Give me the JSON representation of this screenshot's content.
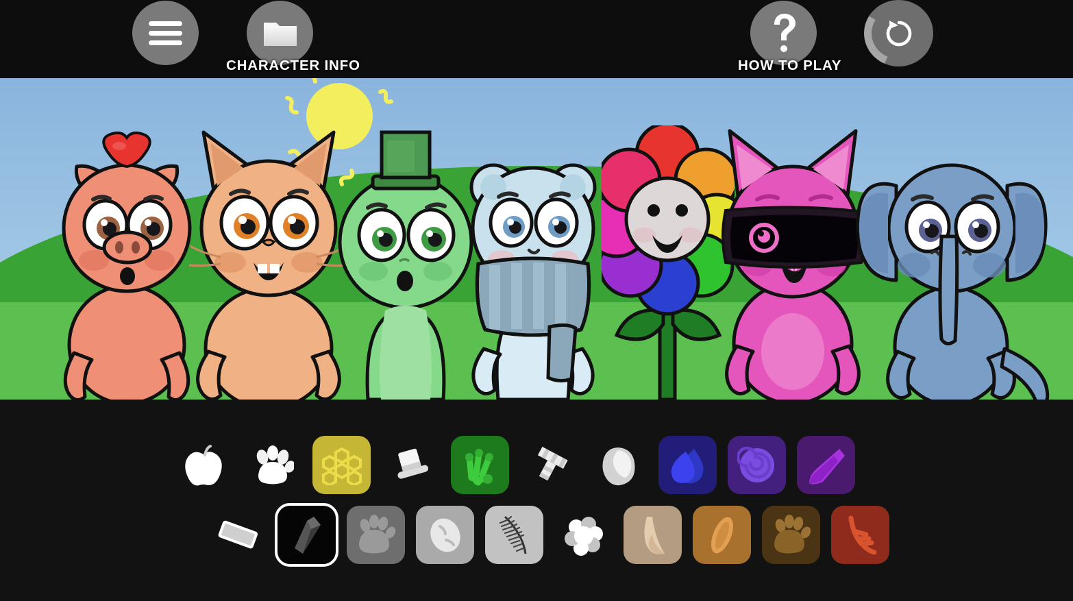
{
  "app": {
    "title": "Character Dress-Up Game",
    "background_color": "#0e0e0e"
  },
  "topbar": {
    "menu_button": {
      "name": "menu",
      "icon": "hamburger-icon",
      "caption": ""
    },
    "character_info_button": {
      "name": "character-info",
      "icon": "folder-icon",
      "caption": "CHARACTER INFO"
    },
    "how_to_play_button": {
      "name": "how-to-play",
      "icon": "question-mark-icon",
      "caption": "HOW TO PLAY"
    },
    "reset_button": {
      "name": "reset",
      "icon": "refresh-icon",
      "caption": "",
      "ring_progress_pct": 26
    },
    "colors": {
      "button_fill": "#7a7a7a",
      "ring_light": "#a6a6a6",
      "ring_dark": "#6e6e6e",
      "bar_bg": "#0d0d0d"
    }
  },
  "scene": {
    "sky_color": "#9ec6e4",
    "hill_color": "#3aa335",
    "ground_color": "#5bc04f",
    "sun_color": "#f3ee5e",
    "characters": [
      {
        "id": "pig",
        "label": "Pig",
        "body_color": "#f0937a",
        "accessory": "apple-on-head",
        "accessory_color": "#e8342f",
        "eye_color": "#9c6241",
        "expression": "surprised"
      },
      {
        "id": "cat-orange",
        "label": "Orange Cat",
        "body_color": "#f0b184",
        "accessory": "none",
        "eye_color": "#e08028",
        "expression": "happy"
      },
      {
        "id": "frog",
        "label": "Frog",
        "body_color": "#84d98a",
        "accessory": "top-hat",
        "accessory_color": "#3e8a43",
        "eye_color": "#3f9a44",
        "expression": "surprised"
      },
      {
        "id": "polar-bear",
        "label": "Polar Bear",
        "body_color": "#c9e1ed",
        "accessory": "striped-scarf",
        "accessory_color": "#7d98ab",
        "eye_color": "#6f9cc4",
        "expression": "sad"
      },
      {
        "id": "flower",
        "label": "Rainbow Flower",
        "body_color": "#ded7d7",
        "accessory": "rainbow-petals",
        "accessory_color": "#e8342f",
        "eye_color": "#000000",
        "expression": "smiling"
      },
      {
        "id": "cat-pink",
        "label": "Pink Cat",
        "body_color": "#e456bb",
        "accessory": "vr-visor",
        "accessory_color": "#15090f",
        "eye_color": "#ef6fc8",
        "expression": "grinning"
      },
      {
        "id": "elephant",
        "label": "Elephant",
        "body_color": "#7b9ec7",
        "accessory": "none",
        "eye_color": "#5b6192",
        "expression": "neutral"
      }
    ]
  },
  "palette": {
    "selected_tile_id": "black-crystal",
    "rows": [
      {
        "row": 1,
        "tiles": [
          {
            "id": "white-apple",
            "icon": "apple-icon",
            "tile_color": "transparent",
            "glyph_color": "#ffffff",
            "glyph2": "#cccccc"
          },
          {
            "id": "white-paw",
            "icon": "paw-print-icon",
            "tile_color": "transparent",
            "glyph_color": "#f1f1f1",
            "glyph2": "#ffffff"
          },
          {
            "id": "gold-honeycomb",
            "icon": "honeycomb-icon",
            "tile_color": "#c5b735",
            "glyph_color": "#eddc4a",
            "glyph2": "#d8c83e"
          },
          {
            "id": "white-tophat",
            "icon": "top-hat-icon",
            "tile_color": "transparent",
            "glyph_color": "#f5f5f5",
            "glyph2": "#cfcfcf"
          },
          {
            "id": "green-frogfoot",
            "icon": "frog-foot-icon",
            "tile_color": "#1d7a1d",
            "glyph_color": "#3ecb3e",
            "glyph2": "#35b035"
          },
          {
            "id": "white-scarf",
            "icon": "scarf-icon",
            "tile_color": "transparent",
            "glyph_color": "#ededed",
            "glyph2": "#c9c9c9"
          },
          {
            "id": "gray-pebble",
            "icon": "pebble-icon",
            "tile_color": "transparent",
            "glyph_color": "#d2d2d2",
            "glyph2": "#ffffff"
          },
          {
            "id": "blue-flame",
            "icon": "flame-icon",
            "tile_color": "#231d7a",
            "glyph_color": "#3b42ee",
            "glyph2": "#2f38c6"
          },
          {
            "id": "purple-spiral",
            "icon": "spiral-icon",
            "tile_color": "#43207d",
            "glyph_color": "#7c4ce0",
            "glyph2": "#6a3ecb"
          },
          {
            "id": "purple-tail",
            "icon": "brush-tail-icon",
            "tile_color": "#4a1a6e",
            "glyph_color": "#a832e0",
            "glyph2": "#8f22c6"
          }
        ]
      },
      {
        "row": 2,
        "tiles": [
          {
            "id": "white-bandage",
            "icon": "bandage-icon",
            "tile_color": "transparent",
            "glyph_color": "#cfcfcf",
            "glyph2": "#ffffff"
          },
          {
            "id": "black-crystal",
            "icon": "crystal-icon",
            "tile_color": "#050505",
            "glyph_color": "#555555",
            "glyph2": "#3a3a3a",
            "selected": true
          },
          {
            "id": "gray-bearpaw",
            "icon": "bear-paw-icon",
            "tile_color": "#6e6e6e",
            "glyph_color": "#9a9a9a",
            "glyph2": "#8a8a8a"
          },
          {
            "id": "gray-egg",
            "icon": "egg-icon",
            "tile_color": "#aaaaaa",
            "glyph_color": "#e8e8e8",
            "glyph2": "#cbcbcb"
          },
          {
            "id": "gray-feather",
            "icon": "feather-icon",
            "tile_color": "#c2c2c2",
            "glyph_color": "#444444",
            "glyph2": "#2e2e2e"
          },
          {
            "id": "white-cloud",
            "icon": "cloud-puff-icon",
            "tile_color": "transparent",
            "glyph_color": "#ffffff",
            "glyph2": "#c4c4c4"
          },
          {
            "id": "tan-horn",
            "icon": "horn-icon",
            "tile_color": "#b49c82",
            "glyph_color": "#e3cdae",
            "glyph2": "#d4b796"
          },
          {
            "id": "brown-seed",
            "icon": "seed-icon",
            "tile_color": "#a8712e",
            "glyph_color": "#e2a052",
            "glyph2": "#cf8d3f"
          },
          {
            "id": "darkbrown-paw",
            "icon": "bear-paw-icon",
            "tile_color": "#4a3414",
            "glyph_color": "#9b7233",
            "glyph2": "#8a6329"
          },
          {
            "id": "red-antler",
            "icon": "antler-icon",
            "tile_color": "#8f2b1d",
            "glyph_color": "#d8542f",
            "glyph2": "#c14526"
          }
        ]
      }
    ]
  }
}
